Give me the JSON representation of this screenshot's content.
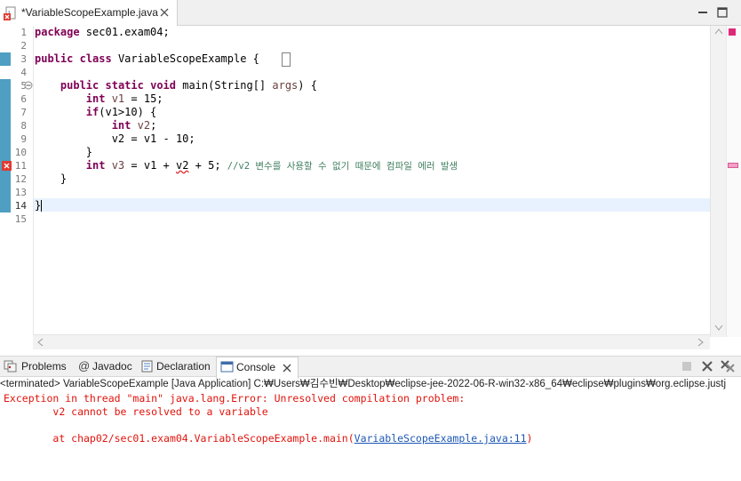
{
  "editor": {
    "tab_title": "*VariableScopeExample.java",
    "line_numbers": [
      "1",
      "2",
      "3",
      "4",
      "5",
      "6",
      "7",
      "8",
      "9",
      "10",
      "11",
      "12",
      "13",
      "14",
      "15"
    ],
    "lines": {
      "l1": {
        "kw": "package",
        "rest": " sec01.exam04;"
      },
      "l3": {
        "kw1": "public",
        "kw2": "class",
        "rest": " VariableScopeExample ",
        "brace": "{"
      },
      "l5": {
        "kw1": "public",
        "kw2": "static",
        "kw3": "void",
        "name": " main(String[] ",
        "arg": "args",
        "rest": ") {"
      },
      "l6": {
        "kw": "int",
        "var": " v1",
        "rest": " = 15;"
      },
      "l7": {
        "kw": "if",
        "rest": "(v1>10) {"
      },
      "l8": {
        "kw": "int",
        "var": " v2",
        "rest": ";"
      },
      "l9": {
        "text": "v2 = v1 - 10;"
      },
      "l10": {
        "text": "}"
      },
      "l11": {
        "kw": "int",
        "var": " v3",
        "mid": " = v1 + ",
        "err": "v2",
        "rest": " + 5; ",
        "comment": "//v2 변수를 사용할 수 없기 때문에 컴파일 에러 발생"
      },
      "l12": {
        "text": "}"
      },
      "l14": {
        "text": "}"
      }
    }
  },
  "panel": {
    "tabs": [
      "Problems",
      "Javadoc",
      "Declaration",
      "Console"
    ],
    "active_tab": "Console",
    "terminated_line": "<terminated> VariableScopeExample [Java Application] C:₩Users₩김수빈₩Desktop₩eclipse-jee-2022-06-R-win32-x86_64₩eclipse₩plugins₩org.eclipse.justj",
    "output": {
      "line1": "Exception in thread \"main\" java.lang.Error: Unresolved compilation problem: ",
      "line2": "\tv2 cannot be resolved to a variable",
      "line3_prefix": "\tat chap02/sec01.exam04.VariableScopeExample.main(",
      "line3_link": "VariableScopeExample.java:11",
      "line3_suffix": ")"
    }
  },
  "colors": {
    "keyword": "#7f0055",
    "comment": "#3f7f5f",
    "error_text": "#e0140c",
    "link": "#1d57b5",
    "change_bar": "#4e9fc1"
  }
}
